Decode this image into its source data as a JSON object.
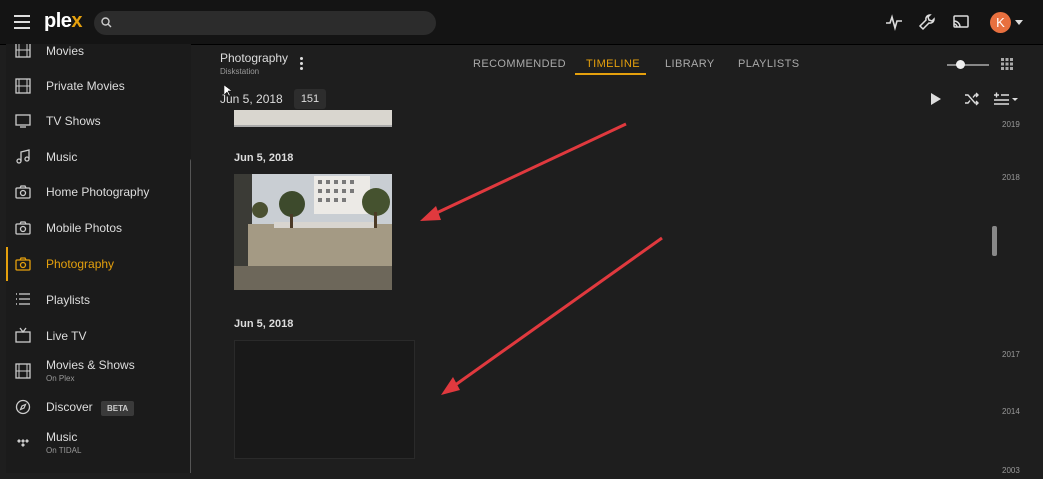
{
  "app": {
    "logo_text": "ple",
    "logo_accent": "x"
  },
  "search": {
    "placeholder": "",
    "value": ""
  },
  "header_icons": [
    "activity-icon",
    "wrench-icon",
    "cast-icon"
  ],
  "user": {
    "avatar_letter": "K",
    "avatar_color": "#e8703f"
  },
  "sidebar": {
    "items": [
      {
        "label": "Movies",
        "icon": "film-icon"
      },
      {
        "label": "Private Movies",
        "icon": "film-icon"
      },
      {
        "label": "TV Shows",
        "icon": "tv-icon"
      },
      {
        "label": "Music",
        "icon": "music-note-icon"
      },
      {
        "label": "Home Photography",
        "icon": "camera-icon"
      },
      {
        "label": "Mobile Photos",
        "icon": "camera-icon"
      },
      {
        "label": "Photography",
        "icon": "camera-icon",
        "active": true
      },
      {
        "label": "Playlists",
        "icon": "list-icon"
      },
      {
        "label": "Live TV",
        "icon": "live-tv-icon"
      },
      {
        "label": "Movies & Shows",
        "sub": "On Plex",
        "icon": "film-icon"
      },
      {
        "label": "Discover",
        "badge": "BETA",
        "icon": "compass-icon"
      },
      {
        "label": "Music",
        "sub": "On TIDAL",
        "icon": "tidal-icon"
      }
    ]
  },
  "library": {
    "title": "Photography",
    "server": "Diskstation"
  },
  "tabs": [
    {
      "label": "RECOMMENDED"
    },
    {
      "label": "TIMELINE",
      "active": true
    },
    {
      "label": "LIBRARY"
    },
    {
      "label": "PLAYLISTS"
    }
  ],
  "toolbar": {
    "date": "Jun 5, 2018",
    "count": "151"
  },
  "groups": [
    {
      "date": "Jun 5, 2018"
    },
    {
      "date": "Jun 5, 2018"
    }
  ],
  "timeline": {
    "years": [
      "2019",
      "2018",
      "2017",
      "2014",
      "2003"
    ]
  },
  "colors": {
    "accent": "#e5a00d",
    "annotation_arrow": "#e0393e",
    "background": "#1e1e1e"
  }
}
